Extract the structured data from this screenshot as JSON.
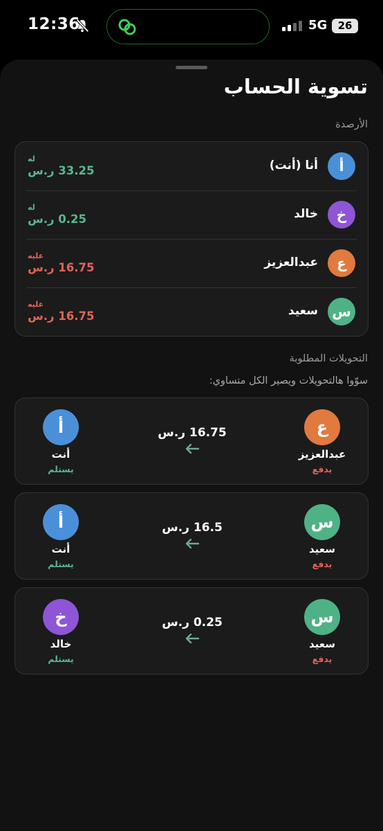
{
  "status_bar": {
    "time": "12:36",
    "network": "5G",
    "battery": "26",
    "icons": [
      "bell-slash-icon",
      "link-icon",
      "signal-icon"
    ]
  },
  "sheet": {
    "title": "تسوية الحساب",
    "balances_label": "الأرصدة",
    "balances": [
      {
        "initial": "أ",
        "name": "أنا (أنت)",
        "tag": "له",
        "amount": "33.25 ر.س",
        "avatar_color": "#4a90d9",
        "status": "credit"
      },
      {
        "initial": "خ",
        "name": "خالد",
        "tag": "له",
        "amount": "0.25 ر.س",
        "avatar_color": "#8e55d6",
        "status": "credit"
      },
      {
        "initial": "ع",
        "name": "عبدالعزيز",
        "tag": "عليه",
        "amount": "16.75 ر.س",
        "avatar_color": "#e07a3e",
        "status": "debit"
      },
      {
        "initial": "س",
        "name": "سعيد",
        "tag": "عليه",
        "amount": "16.75 ر.س",
        "avatar_color": "#4fb286",
        "status": "debit"
      }
    ],
    "transfers_label": "التحويلات المطلوبة",
    "transfers_subtitle": "سوّوا هالتحويلات ويصير الكل متساوي:",
    "transfers": [
      {
        "payer": {
          "initial": "ع",
          "name": "عبدالعزيز",
          "role": "يدفع",
          "avatar_color": "#e07a3e"
        },
        "payee": {
          "initial": "أ",
          "name": "أنت",
          "role": "يستلم",
          "avatar_color": "#4a90d9"
        },
        "amount": "16.75 ر.س"
      },
      {
        "payer": {
          "initial": "س",
          "name": "سعيد",
          "role": "يدفع",
          "avatar_color": "#4fb286"
        },
        "payee": {
          "initial": "أ",
          "name": "أنت",
          "role": "يستلم",
          "avatar_color": "#4a90d9"
        },
        "amount": "16.5 ر.س"
      },
      {
        "payer": {
          "initial": "س",
          "name": "سعيد",
          "role": "يدفع",
          "avatar_color": "#4fb286"
        },
        "payee": {
          "initial": "خ",
          "name": "خالد",
          "role": "يستلم",
          "avatar_color": "#8e55d6"
        },
        "amount": "0.25 ر.س"
      }
    ]
  },
  "colors": {
    "credit": "#59b790",
    "debit": "#e0645a",
    "arrow": "#6fa98f"
  }
}
